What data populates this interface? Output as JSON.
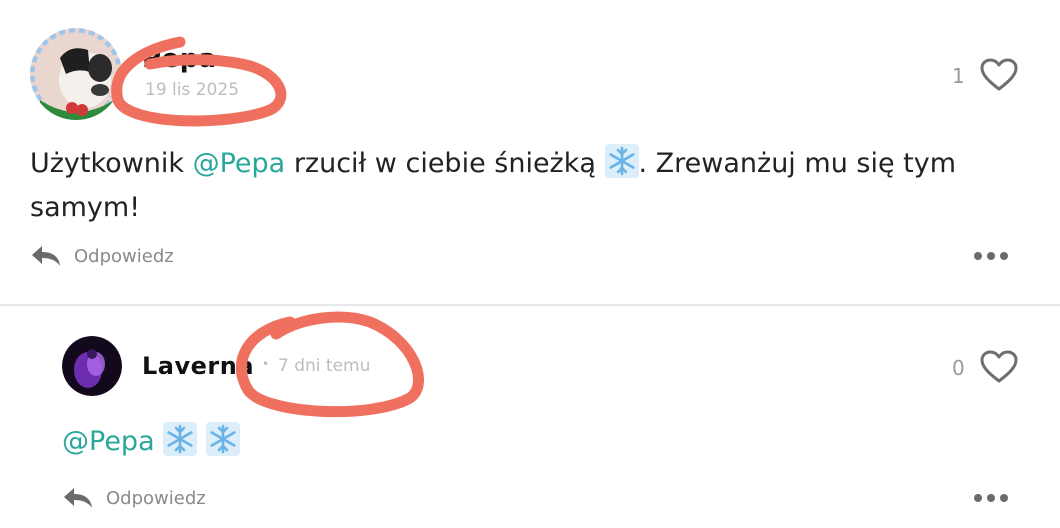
{
  "comment": {
    "username": "Pepa",
    "date": "19 lis 2025",
    "likes": "1",
    "text_before": "Użytkownik ",
    "mention": "@Pepa",
    "text_after": " rzucił w ciebie śnieżką",
    "text_end": ". Zrewanżuj mu się tym samym!",
    "reply_label": "Odpowiedz"
  },
  "reply_comment": {
    "username": "Laverna",
    "separator": "•",
    "date": "7 dni temu",
    "likes": "0",
    "mention": "@Pepa",
    "reply_label": "Odpowiedz"
  },
  "icons": {
    "heart": "heart-outline-icon",
    "reply": "reply-arrow-icon",
    "more": "more-dots-icon",
    "snowflake": "snowflake-icon"
  },
  "colors": {
    "mention": "#2aa79b",
    "annotation": "#f07060",
    "muted": "#bdbdbd"
  }
}
